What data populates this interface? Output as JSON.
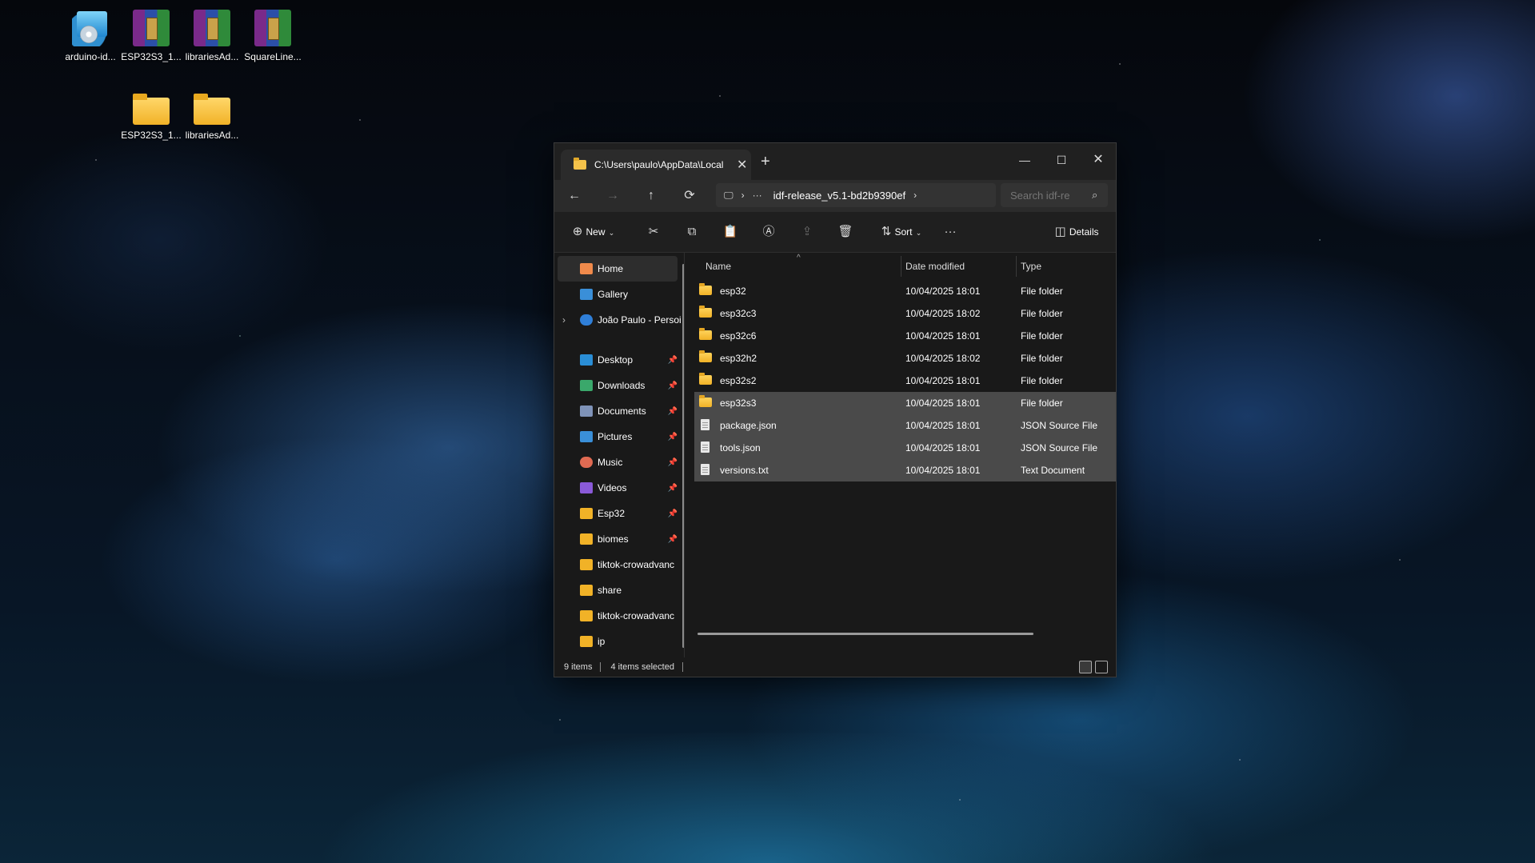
{
  "desktop": {
    "icons": [
      {
        "label": "arduino-id...",
        "kind": "setup"
      },
      {
        "label": "ESP32S3_1...",
        "kind": "rar"
      },
      {
        "label": "librariesAd...",
        "kind": "rar"
      },
      {
        "label": "SquareLine...",
        "kind": "rar"
      },
      {
        "label": "ESP32S3_1...",
        "kind": "folder"
      },
      {
        "label": "librariesAd...",
        "kind": "folder"
      }
    ]
  },
  "explorer": {
    "tab": {
      "title": "C:\\Users\\paulo\\AppData\\Local",
      "close": "✕",
      "new": "+"
    },
    "window_controls": {
      "minimize": "—",
      "maximize": "☐",
      "close": "✕"
    },
    "nav": {
      "back": "←",
      "forward": "→",
      "up": "↑",
      "refresh": "⟳"
    },
    "address": {
      "computer_icon": "🖵",
      "chevron": "›",
      "ellipsis": "···",
      "path": "idf-release_v5.1-bd2b9390ef",
      "end_chevron": "›"
    },
    "search": {
      "placeholder": "Search idf-re",
      "icon": "⌕"
    },
    "commands": {
      "new_label": "New",
      "sort_label": "Sort",
      "more": "···",
      "details_label": "Details"
    },
    "sidebar": {
      "items": [
        {
          "label": "Home",
          "icon": "home-icon",
          "color": "#f08a4b"
        },
        {
          "label": "Gallery",
          "icon": "gallery-icon",
          "color": "#3a8fd8"
        },
        {
          "label": "João Paulo - Persoi",
          "icon": "cloud-icon",
          "color": "#2f7fd8"
        },
        {
          "label": "Desktop",
          "icon": "desktop-icon",
          "color": "#2a8ed6"
        },
        {
          "label": "Downloads",
          "icon": "download-icon",
          "color": "#3aa86b"
        },
        {
          "label": "Documents",
          "icon": "documents-icon",
          "color": "#7f93b8"
        },
        {
          "label": "Pictures",
          "icon": "pictures-icon",
          "color": "#3a8fd8"
        },
        {
          "label": "Music",
          "icon": "music-icon",
          "color": "#e06a52"
        },
        {
          "label": "Videos",
          "icon": "videos-icon",
          "color": "#8a5ad8"
        },
        {
          "label": "Esp32",
          "icon": "folder-icon",
          "color": "#f1b227"
        },
        {
          "label": "biomes",
          "icon": "folder-icon",
          "color": "#f1b227"
        },
        {
          "label": "tiktok-crowadvanc",
          "icon": "folder-icon",
          "color": "#f1b227"
        },
        {
          "label": "share",
          "icon": "folder-icon",
          "color": "#f1b227"
        },
        {
          "label": "tiktok-crowadvanc",
          "icon": "folder-icon",
          "color": "#f1b227"
        },
        {
          "label": "ip",
          "icon": "folder-icon",
          "color": "#f1b227"
        }
      ],
      "expand_chevron": "›",
      "pin": "📌"
    },
    "columns": {
      "name": "Name",
      "date": "Date modified",
      "type": "Type",
      "sort_caret": "^"
    },
    "files": [
      {
        "name": "esp32",
        "date": "10/04/2025 18:01",
        "type": "File folder",
        "kind": "folder",
        "selected": false
      },
      {
        "name": "esp32c3",
        "date": "10/04/2025 18:02",
        "type": "File folder",
        "kind": "folder",
        "selected": false
      },
      {
        "name": "esp32c6",
        "date": "10/04/2025 18:01",
        "type": "File folder",
        "kind": "folder",
        "selected": false
      },
      {
        "name": "esp32h2",
        "date": "10/04/2025 18:02",
        "type": "File folder",
        "kind": "folder",
        "selected": false
      },
      {
        "name": "esp32s2",
        "date": "10/04/2025 18:01",
        "type": "File folder",
        "kind": "folder",
        "selected": false
      },
      {
        "name": "esp32s3",
        "date": "10/04/2025 18:01",
        "type": "File folder",
        "kind": "folder",
        "selected": true
      },
      {
        "name": "package.json",
        "date": "10/04/2025 18:01",
        "type": "JSON Source File",
        "kind": "doc",
        "selected": true
      },
      {
        "name": "tools.json",
        "date": "10/04/2025 18:01",
        "type": "JSON Source File",
        "kind": "doc",
        "selected": true
      },
      {
        "name": "versions.txt",
        "date": "10/04/2025 18:01",
        "type": "Text Document",
        "kind": "doc",
        "selected": true
      }
    ],
    "status": {
      "count": "9 items",
      "selected": "4 items selected"
    }
  }
}
